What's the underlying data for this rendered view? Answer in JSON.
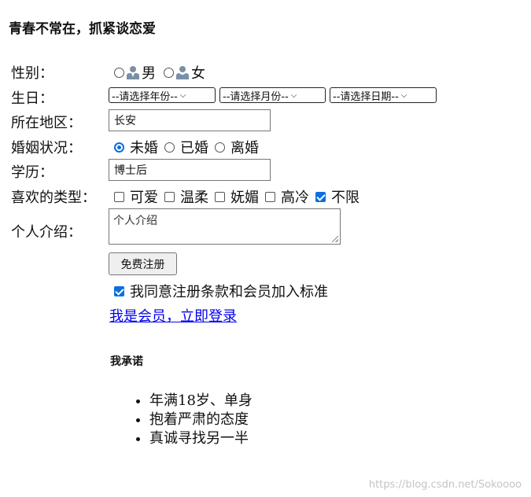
{
  "page": {
    "title": "青春不常在，抓紧谈恋爱"
  },
  "form": {
    "gender": {
      "label": "性别：",
      "options": [
        "男",
        "女"
      ],
      "selected": null
    },
    "birthday": {
      "label": "生日：",
      "year_selected": "--请选择年份--",
      "month_selected": "--请选择月份--",
      "day_selected": "--请选择日期--"
    },
    "region": {
      "label": "所在地区：",
      "value": "长安"
    },
    "marital": {
      "label": "婚姻状况：",
      "options": [
        "未婚",
        "已婚",
        "离婚"
      ],
      "selected": "未婚"
    },
    "education": {
      "label": "学历：",
      "value": "博士后"
    },
    "preferences": {
      "label": "喜欢的类型：",
      "options": [
        {
          "label": "可爱",
          "checked": false
        },
        {
          "label": "温柔",
          "checked": false
        },
        {
          "label": "妩媚",
          "checked": false
        },
        {
          "label": "高冷",
          "checked": false
        },
        {
          "label": "不限",
          "checked": true
        }
      ]
    },
    "intro": {
      "label": "个人介绍：",
      "value": "个人介绍"
    },
    "submit_label": "免费注册",
    "agree": {
      "label": "我同意注册条款和会员加入标准",
      "checked": true
    },
    "login_link": "我是会员，立即登录"
  },
  "promise": {
    "title": "我承诺",
    "items": [
      "年满18岁、单身",
      "抱着严肃的态度",
      "真诚寻找另一半"
    ]
  },
  "watermark": "https://blog.csdn.net/Sokoooo",
  "colors": {
    "accent": "#0a6fe0",
    "link": "#0000ee"
  },
  "icons": {
    "male": "male-user-icon",
    "female": "female-user-icon"
  }
}
